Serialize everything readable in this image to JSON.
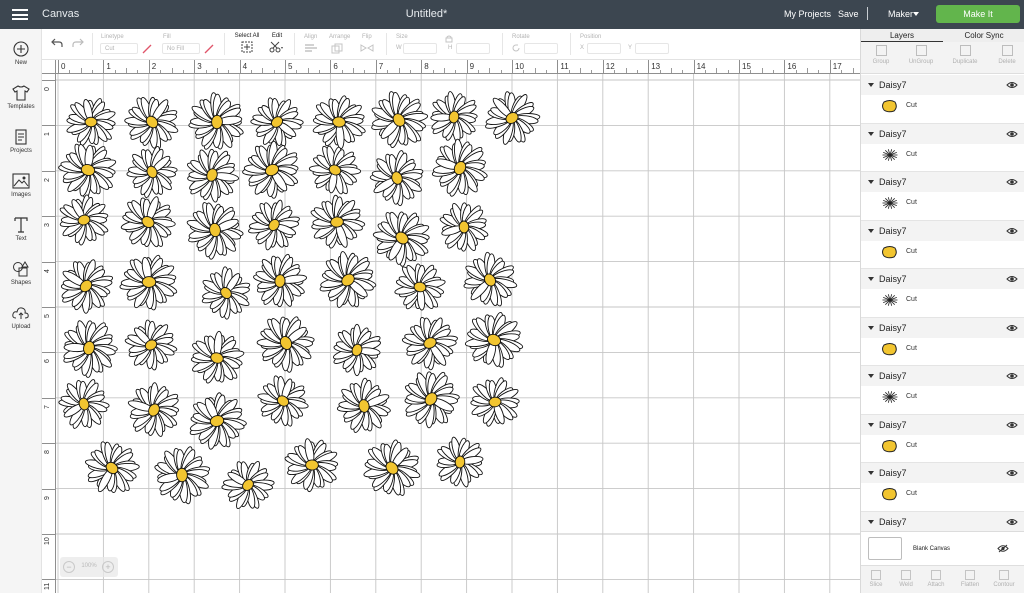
{
  "app": {
    "name": "Canvas",
    "document_title": "Untitled*"
  },
  "topbar": {
    "my_projects": "My Projects",
    "save": "Save",
    "separator": "|",
    "machine": "Maker",
    "make_it": "Make It"
  },
  "toolbar": {
    "linetype_label": "Linetype",
    "linetype_value": "Cut",
    "fill_label": "Fill",
    "fill_value": "No Fill",
    "select_all": "Select All",
    "edit": "Edit",
    "align": "Align",
    "arrange": "Arrange",
    "flip": "Flip",
    "size": "Size",
    "size_w": "W",
    "size_h": "H",
    "rotate": "Rotate",
    "position": "Position",
    "pos_x": "X",
    "pos_y": "Y"
  },
  "sidebar": {
    "items": [
      {
        "label": "New",
        "icon": "plus-circle-icon"
      },
      {
        "label": "Templates",
        "icon": "shirt-icon"
      },
      {
        "label": "Projects",
        "icon": "projects-icon"
      },
      {
        "label": "Images",
        "icon": "image-icon"
      },
      {
        "label": "Text",
        "icon": "text-icon"
      },
      {
        "label": "Shapes",
        "icon": "shapes-icon"
      },
      {
        "label": "Upload",
        "icon": "cloud-upload-icon"
      }
    ]
  },
  "rulers": {
    "top": [
      "0",
      "1",
      "2",
      "3",
      "4",
      "5",
      "6",
      "7",
      "8",
      "9",
      "10",
      "11",
      "12",
      "13",
      "14",
      "15",
      "16",
      "17"
    ],
    "left": [
      "0",
      "1",
      "2",
      "3",
      "4",
      "5",
      "6",
      "7",
      "8",
      "9",
      "10",
      "11"
    ]
  },
  "zoom": {
    "minus": "−",
    "level": "100%",
    "plus": "+"
  },
  "layers_panel": {
    "tabs": [
      "Layers",
      "Color Sync"
    ],
    "tools": [
      "Group",
      "UnGroup",
      "Duplicate",
      "Delete"
    ],
    "groups": [
      {
        "name": "Daisy7",
        "operation": "Cut",
        "thumb": "daisy-center"
      },
      {
        "name": "Daisy7",
        "operation": "Cut",
        "thumb": "daisy-petals"
      },
      {
        "name": "Daisy7",
        "operation": "Cut",
        "thumb": "daisy-petals"
      },
      {
        "name": "Daisy7",
        "operation": "Cut",
        "thumb": "daisy-center"
      },
      {
        "name": "Daisy7",
        "operation": "Cut",
        "thumb": "daisy-petals"
      },
      {
        "name": "Daisy7",
        "operation": "Cut",
        "thumb": "daisy-center"
      },
      {
        "name": "Daisy7",
        "operation": "Cut",
        "thumb": "daisy-petals"
      },
      {
        "name": "Daisy7",
        "operation": "Cut",
        "thumb": "daisy-center"
      },
      {
        "name": "Daisy7",
        "operation": "Cut",
        "thumb": "daisy-center"
      },
      {
        "name": "Daisy7",
        "operation": "",
        "thumb": ""
      }
    ],
    "blank_canvas": "Blank Canvas",
    "bottom_tools": [
      "Slice",
      "Weld",
      "Attach",
      "Flatten",
      "Contour"
    ]
  },
  "colors": {
    "topbar": "#3c4650",
    "make_it": "#62b54c",
    "daisy_center": "#f2c530"
  }
}
